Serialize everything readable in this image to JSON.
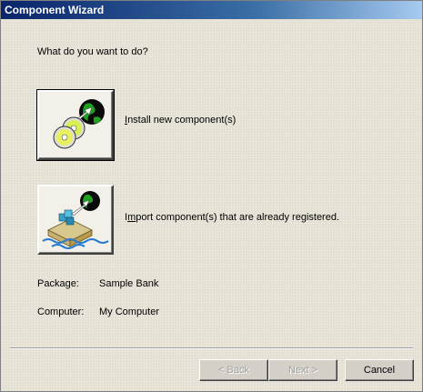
{
  "window": {
    "title": "Component Wizard"
  },
  "main": {
    "prompt": "What do you want to do?",
    "options": [
      {
        "id": "install",
        "accel": "I",
        "rest": "nstall new component(s)",
        "icon": "cd-install-icon"
      },
      {
        "id": "import",
        "accel": "m",
        "prefix": "I",
        "rest": "port component(s) that are already registered.",
        "icon": "import-components-icon"
      }
    ],
    "info": {
      "package_label": "Package:",
      "package_value": "Sample Bank",
      "computer_label": "Computer:",
      "computer_value": "My Computer"
    }
  },
  "footer": {
    "back_label": "< Back",
    "next_label": "Next >",
    "cancel_label": "Cancel"
  },
  "colors": {
    "titlebar_start": "#0a246a",
    "titlebar_end": "#a6caf0",
    "window_bg": "#e4e1d4"
  }
}
